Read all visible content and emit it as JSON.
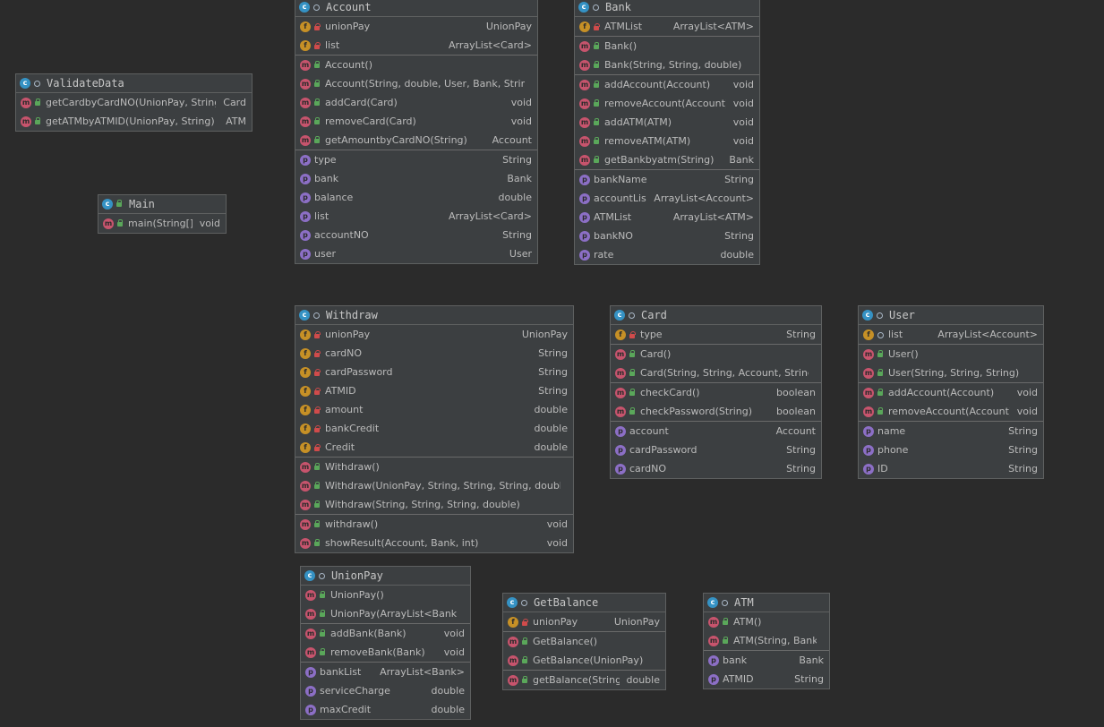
{
  "classes": {
    "validatedata": {
      "name": "ValidateData",
      "sections": [
        [
          {
            "kind": "m",
            "vis": "pub",
            "name": "getCardbyCardNO(UnionPay, String)",
            "type": "Card"
          },
          {
            "kind": "m",
            "vis": "pub",
            "name": "getATMbyATMID(UnionPay, String)",
            "type": "ATM"
          }
        ]
      ]
    },
    "main": {
      "name": "Main",
      "sections": [
        [
          {
            "kind": "m",
            "vis": "pub",
            "name": "main(String[])",
            "type": "void"
          }
        ]
      ]
    },
    "account": {
      "name": "Account",
      "sections": [
        [
          {
            "kind": "f",
            "vis": "priv",
            "name": "unionPay",
            "type": "UnionPay"
          },
          {
            "kind": "f",
            "vis": "priv",
            "name": "list",
            "type": "ArrayList<Card>"
          }
        ],
        [
          {
            "kind": "m",
            "vis": "pub",
            "name": "Account()",
            "type": ""
          },
          {
            "kind": "m",
            "vis": "pub",
            "name": "Account(String, double, User, Bank, String)",
            "type": ""
          },
          {
            "kind": "m",
            "vis": "pub",
            "name": "addCard(Card)",
            "type": "void"
          },
          {
            "kind": "m",
            "vis": "pub",
            "name": "removeCard(Card)",
            "type": "void"
          },
          {
            "kind": "m",
            "vis": "pub",
            "name": "getAmountbyCardNO(String)",
            "type": "Account"
          }
        ],
        [
          {
            "kind": "p",
            "vis": "none",
            "name": "type",
            "type": "String"
          },
          {
            "kind": "p",
            "vis": "none",
            "name": "bank",
            "type": "Bank"
          },
          {
            "kind": "p",
            "vis": "none",
            "name": "balance",
            "type": "double"
          },
          {
            "kind": "p",
            "vis": "none",
            "name": "list",
            "type": "ArrayList<Card>"
          },
          {
            "kind": "p",
            "vis": "none",
            "name": "accountNO",
            "type": "String"
          },
          {
            "kind": "p",
            "vis": "none",
            "name": "user",
            "type": "User"
          }
        ]
      ]
    },
    "bank": {
      "name": "Bank",
      "sections": [
        [
          {
            "kind": "f",
            "vis": "priv",
            "name": "ATMList",
            "type": "ArrayList<ATM>"
          }
        ],
        [
          {
            "kind": "m",
            "vis": "pub",
            "name": "Bank()",
            "type": ""
          },
          {
            "kind": "m",
            "vis": "pub",
            "name": "Bank(String, String, double)",
            "type": ""
          }
        ],
        [
          {
            "kind": "m",
            "vis": "pub",
            "name": "addAccount(Account)",
            "type": "void"
          },
          {
            "kind": "m",
            "vis": "pub",
            "name": "removeAccount(Account)",
            "type": "void"
          },
          {
            "kind": "m",
            "vis": "pub",
            "name": "addATM(ATM)",
            "type": "void"
          },
          {
            "kind": "m",
            "vis": "pub",
            "name": "removeATM(ATM)",
            "type": "void"
          },
          {
            "kind": "m",
            "vis": "pub",
            "name": "getBankbyatm(String)",
            "type": "Bank"
          }
        ],
        [
          {
            "kind": "p",
            "vis": "none",
            "name": "bankName",
            "type": "String"
          },
          {
            "kind": "p",
            "vis": "none",
            "name": "accountList",
            "type": "ArrayList<Account>"
          },
          {
            "kind": "p",
            "vis": "none",
            "name": "ATMList",
            "type": "ArrayList<ATM>"
          },
          {
            "kind": "p",
            "vis": "none",
            "name": "bankNO",
            "type": "String"
          },
          {
            "kind": "p",
            "vis": "none",
            "name": "rate",
            "type": "double"
          }
        ]
      ]
    },
    "withdraw": {
      "name": "Withdraw",
      "sections": [
        [
          {
            "kind": "f",
            "vis": "priv",
            "name": "unionPay",
            "type": "UnionPay"
          },
          {
            "kind": "f",
            "vis": "priv",
            "name": "cardNO",
            "type": "String"
          },
          {
            "kind": "f",
            "vis": "priv",
            "name": "cardPassword",
            "type": "String"
          },
          {
            "kind": "f",
            "vis": "priv",
            "name": "ATMID",
            "type": "String"
          },
          {
            "kind": "f",
            "vis": "priv",
            "name": "amount",
            "type": "double"
          },
          {
            "kind": "f",
            "vis": "priv",
            "name": "bankCredit",
            "type": "double"
          },
          {
            "kind": "f",
            "vis": "priv",
            "name": "Credit",
            "type": "double"
          }
        ],
        [
          {
            "kind": "m",
            "vis": "pub",
            "name": "Withdraw()",
            "type": ""
          },
          {
            "kind": "m",
            "vis": "pub",
            "name": "Withdraw(UnionPay, String, String, String, double)",
            "type": ""
          },
          {
            "kind": "m",
            "vis": "pub",
            "name": "Withdraw(String, String, String, double)",
            "type": ""
          }
        ],
        [
          {
            "kind": "m",
            "vis": "pub",
            "name": "withdraw()",
            "type": "void"
          },
          {
            "kind": "m",
            "vis": "pub",
            "name": "showResult(Account, Bank, int)",
            "type": "void"
          }
        ]
      ]
    },
    "card": {
      "name": "Card",
      "sections": [
        [
          {
            "kind": "f",
            "vis": "priv",
            "name": "type",
            "type": "String"
          }
        ],
        [
          {
            "kind": "m",
            "vis": "pub",
            "name": "Card()",
            "type": ""
          },
          {
            "kind": "m",
            "vis": "pub",
            "name": "Card(String, String, Account, String)",
            "type": ""
          }
        ],
        [
          {
            "kind": "m",
            "vis": "pub",
            "name": "checkCard()",
            "type": "boolean"
          },
          {
            "kind": "m",
            "vis": "pub",
            "name": "checkPassword(String)",
            "type": "boolean"
          }
        ],
        [
          {
            "kind": "p",
            "vis": "none",
            "name": "account",
            "type": "Account"
          },
          {
            "kind": "p",
            "vis": "none",
            "name": "cardPassword",
            "type": "String"
          },
          {
            "kind": "p",
            "vis": "none",
            "name": "cardNO",
            "type": "String"
          }
        ]
      ]
    },
    "user": {
      "name": "User",
      "sections": [
        [
          {
            "kind": "f",
            "vis": "pkg",
            "name": "list",
            "type": "ArrayList<Account>"
          }
        ],
        [
          {
            "kind": "m",
            "vis": "pub",
            "name": "User()",
            "type": ""
          },
          {
            "kind": "m",
            "vis": "pub",
            "name": "User(String, String, String)",
            "type": ""
          }
        ],
        [
          {
            "kind": "m",
            "vis": "pub",
            "name": "addAccount(Account)",
            "type": "void"
          },
          {
            "kind": "m",
            "vis": "pub",
            "name": "removeAccount(Account)",
            "type": "void"
          }
        ],
        [
          {
            "kind": "p",
            "vis": "none",
            "name": "name",
            "type": "String"
          },
          {
            "kind": "p",
            "vis": "none",
            "name": "phone",
            "type": "String"
          },
          {
            "kind": "p",
            "vis": "none",
            "name": "ID",
            "type": "String"
          }
        ]
      ]
    },
    "unionpay": {
      "name": "UnionPay",
      "sections": [
        [
          {
            "kind": "m",
            "vis": "pub",
            "name": "UnionPay()",
            "type": ""
          },
          {
            "kind": "m",
            "vis": "pub",
            "name": "UnionPay(ArrayList<Bank>)",
            "type": ""
          }
        ],
        [
          {
            "kind": "m",
            "vis": "pub",
            "name": "addBank(Bank)",
            "type": "void"
          },
          {
            "kind": "m",
            "vis": "pub",
            "name": "removeBank(Bank)",
            "type": "void"
          }
        ],
        [
          {
            "kind": "p",
            "vis": "none",
            "name": "bankList",
            "type": "ArrayList<Bank>"
          },
          {
            "kind": "p",
            "vis": "none",
            "name": "serviceCharge",
            "type": "double"
          },
          {
            "kind": "p",
            "vis": "none",
            "name": "maxCredit",
            "type": "double"
          }
        ]
      ]
    },
    "getbalance": {
      "name": "GetBalance",
      "sections": [
        [
          {
            "kind": "f",
            "vis": "priv",
            "name": "unionPay",
            "type": "UnionPay"
          }
        ],
        [
          {
            "kind": "m",
            "vis": "pub",
            "name": "GetBalance()",
            "type": ""
          },
          {
            "kind": "m",
            "vis": "pub",
            "name": "GetBalance(UnionPay)",
            "type": ""
          }
        ],
        [
          {
            "kind": "m",
            "vis": "pub",
            "name": "getBalance(String)",
            "type": "double"
          }
        ]
      ]
    },
    "atm": {
      "name": "ATM",
      "sections": [
        [
          {
            "kind": "m",
            "vis": "pub",
            "name": "ATM()",
            "type": ""
          },
          {
            "kind": "m",
            "vis": "pub",
            "name": "ATM(String, Bank)",
            "type": ""
          }
        ],
        [
          {
            "kind": "p",
            "vis": "none",
            "name": "bank",
            "type": "Bank"
          },
          {
            "kind": "p",
            "vis": "none",
            "name": "ATMID",
            "type": "String"
          }
        ]
      ]
    }
  }
}
